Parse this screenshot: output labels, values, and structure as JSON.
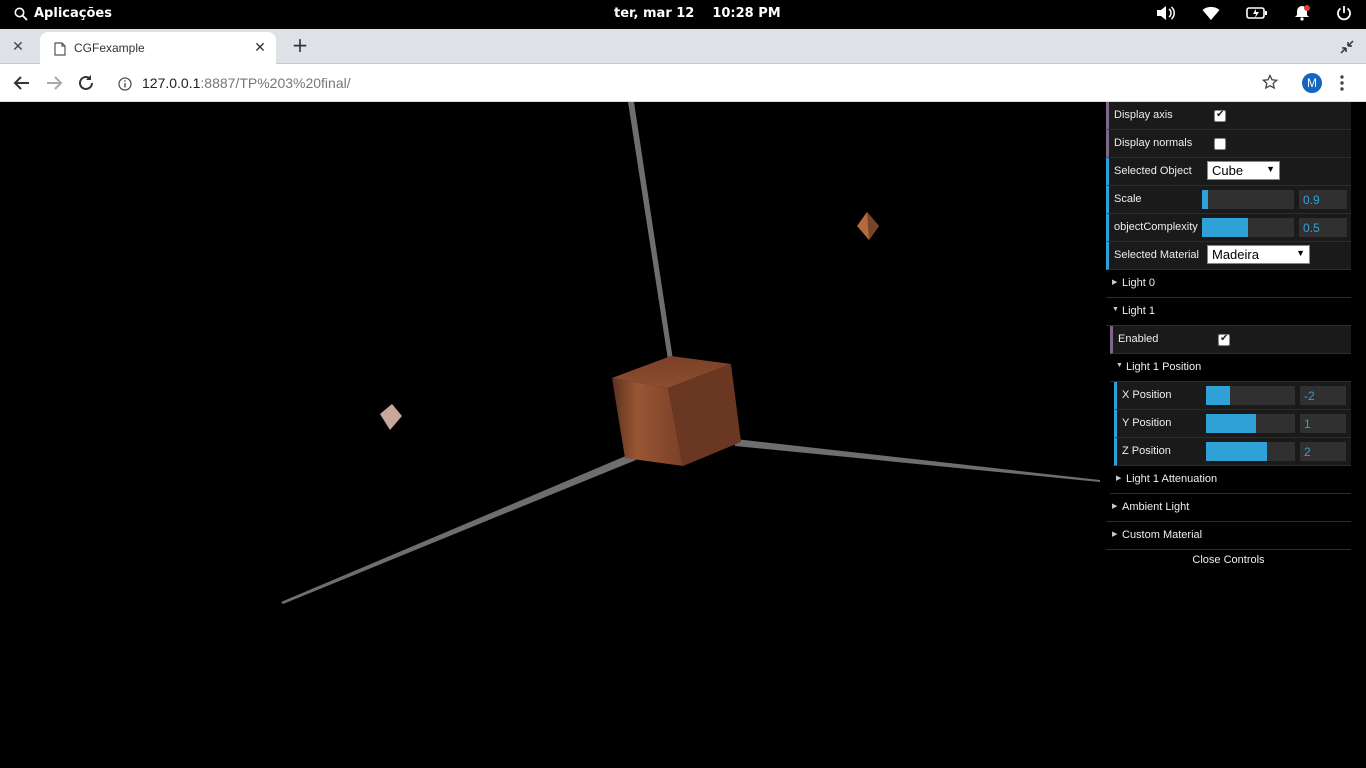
{
  "system_bar": {
    "activities": "Aplicações",
    "date": "ter, mar 12",
    "time": "10:28 PM",
    "tray_icons": [
      "volume-icon",
      "wifi-icon",
      "battery-icon",
      "notification-icon",
      "power-icon"
    ]
  },
  "browser": {
    "tab_title": "CGFexample",
    "url_host": "127.0.0.1",
    "url_rest": ":8887/TP%203%20final/",
    "profile_initial": "M"
  },
  "scene": {
    "object": "Cube",
    "accent": "#8a4a2a"
  },
  "gui": {
    "display_axis": {
      "label": "Display axis",
      "checked": true
    },
    "display_normals": {
      "label": "Display normals",
      "checked": false
    },
    "selected_object": {
      "label": "Selected Object",
      "value": "Cube"
    },
    "scale": {
      "label": "Scale",
      "value": "0.9",
      "fraction": 0.06
    },
    "object_complexity": {
      "label": "objectComplexity",
      "value": "0.5",
      "fraction": 0.5
    },
    "selected_material": {
      "label": "Selected Material",
      "value": "Madeira"
    },
    "light0": {
      "label": "Light 0"
    },
    "light1": {
      "label": "Light 1"
    },
    "enabled": {
      "label": "Enabled",
      "checked": true
    },
    "light1_position": {
      "label": "Light 1 Position"
    },
    "x_position": {
      "label": "X Position",
      "value": "-2",
      "fraction": 0.27
    },
    "y_position": {
      "label": "Y Position",
      "value": "1",
      "fraction": 0.56
    },
    "z_position": {
      "label": "Z Position",
      "value": "2",
      "fraction": 0.69
    },
    "light1_attenuation": {
      "label": "Light 1 Attenuation"
    },
    "ambient_light": {
      "label": "Ambient Light"
    },
    "custom_material": {
      "label": "Custom Material"
    },
    "close_controls": "Close Controls"
  }
}
